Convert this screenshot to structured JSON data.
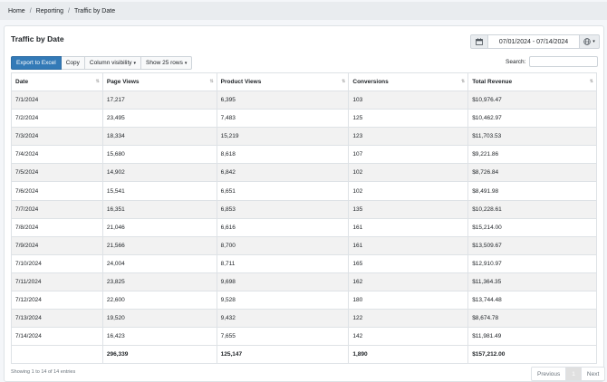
{
  "breadcrumb": {
    "home": "Home",
    "reporting": "Reporting",
    "current": "Traffic by Date",
    "separator": "/"
  },
  "card": {
    "title": "Traffic by Date"
  },
  "date_range": {
    "value": "07/01/2024 - 07/14/2024",
    "calendar_icon": "calendar-icon",
    "globe_icon": "globe-icon"
  },
  "toolbar": {
    "export_label": "Export to Excel",
    "copy_label": "Copy",
    "column_visibility_label": "Column visibility",
    "show_rows_label": "Show 25 rows",
    "caret": "▾"
  },
  "search": {
    "label": "Search:",
    "placeholder": ""
  },
  "table": {
    "headers": [
      "Date",
      "Page Views",
      "Product Views",
      "Conversions",
      "Total Revenue"
    ],
    "sort_glyph": "⇅",
    "rows": [
      [
        "7/1/2024",
        "17,217",
        "6,395",
        "103",
        "$10,976.47"
      ],
      [
        "7/2/2024",
        "23,495",
        "7,483",
        "125",
        "$10,462.97"
      ],
      [
        "7/3/2024",
        "18,334",
        "15,219",
        "123",
        "$11,703.53"
      ],
      [
        "7/4/2024",
        "15,680",
        "8,618",
        "107",
        "$9,221.86"
      ],
      [
        "7/5/2024",
        "14,902",
        "6,842",
        "102",
        "$8,726.84"
      ],
      [
        "7/6/2024",
        "15,541",
        "6,651",
        "102",
        "$8,491.98"
      ],
      [
        "7/7/2024",
        "16,351",
        "6,853",
        "135",
        "$10,228.61"
      ],
      [
        "7/8/2024",
        "21,046",
        "6,616",
        "161",
        "$15,214.00"
      ],
      [
        "7/9/2024",
        "21,566",
        "8,700",
        "161",
        "$13,509.67"
      ],
      [
        "7/10/2024",
        "24,004",
        "8,711",
        "165",
        "$12,910.97"
      ],
      [
        "7/11/2024",
        "23,825",
        "9,698",
        "162",
        "$11,364.35"
      ],
      [
        "7/12/2024",
        "22,600",
        "9,528",
        "180",
        "$13,744.48"
      ],
      [
        "7/13/2024",
        "19,520",
        "9,432",
        "122",
        "$8,674.78"
      ],
      [
        "7/14/2024",
        "16,423",
        "7,655",
        "142",
        "$11,981.49"
      ]
    ],
    "totals": [
      "",
      "296,339",
      "125,147",
      "1,890",
      "$157,212.00"
    ]
  },
  "footer": {
    "info": "Showing 1 to 14 of 14 entries",
    "prev_label": "Previous",
    "page_label": "1",
    "next_label": "Next"
  }
}
